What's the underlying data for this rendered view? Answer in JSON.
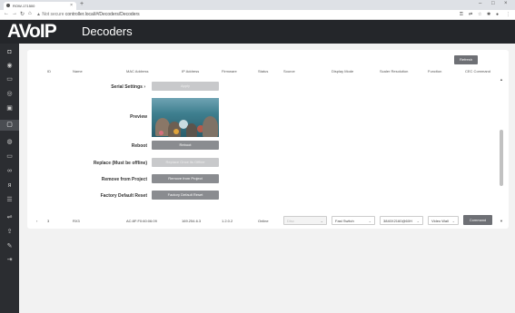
{
  "browser": {
    "tab_title": "ROW-171500",
    "tab_close": "×",
    "new_tab": "+",
    "url_warning": "▲ Not secure",
    "url": "controller.local/#/Decoders/Decoders",
    "window_controls": [
      "–",
      "□",
      "×"
    ]
  },
  "app": {
    "logo": "AVoIP",
    "page_title": "Decoders"
  },
  "sidebar": {
    "items": [
      {
        "icon": "dashboard-icon",
        "glyph": "◘"
      },
      {
        "icon": "source-icon",
        "glyph": "◉"
      },
      {
        "icon": "encoders-icon",
        "glyph": "▭"
      },
      {
        "icon": "globe-icon",
        "glyph": "◎"
      },
      {
        "icon": "device-icon",
        "glyph": "▣"
      },
      {
        "icon": "decoders-icon",
        "glyph": "▢"
      },
      {
        "icon": "settings-icon",
        "glyph": "◍"
      },
      {
        "icon": "video-wall-icon",
        "glyph": "▭"
      },
      {
        "icon": "link-icon",
        "glyph": "∞"
      },
      {
        "icon": "user-icon",
        "glyph": "ᴙ"
      },
      {
        "icon": "list-icon",
        "glyph": "☰"
      },
      {
        "icon": "network-icon",
        "glyph": "⇌"
      },
      {
        "icon": "upload-icon",
        "glyph": "⇪"
      },
      {
        "icon": "tools-icon",
        "glyph": "✎"
      },
      {
        "icon": "logout-icon",
        "glyph": "⇥"
      }
    ]
  },
  "toolbar": {
    "refresh_label": "Refresh"
  },
  "table": {
    "headers": [
      "ID",
      "Name",
      "MAC Address",
      "IP Address",
      "Firmware",
      "Status",
      "Source",
      "Display Mode",
      "Scaler Resolution",
      "Function",
      "CEC Command"
    ],
    "row": {
      "id": "3",
      "name": "RX3",
      "mac": "AC:8F:F0:60:06:09",
      "ip": "169.254.6.3",
      "firmware": "1.2.0.2",
      "status": "Online",
      "source": "Disc",
      "display_mode": "Fast Switch",
      "scaler_resolution": "3840X2160@60H",
      "function": "Video Wall",
      "cec_command": "Command"
    }
  },
  "details": {
    "serial_settings_label": "Serial Settings",
    "serial_settings_arrow": "›",
    "apply_label": "Apply",
    "preview_label": "Preview",
    "reboot_label": "Reboot",
    "reboot_button": "Reboot",
    "replace_label": "Replace (Must be offline)",
    "replace_button": "Replace Once its Offline",
    "remove_label": "Remove from Project",
    "remove_button": "Remove from Project",
    "reset_label": "Factory Default Reset",
    "reset_button": "Factory Default Reset"
  },
  "colors": {
    "header_bg": "#24262a",
    "sidebar_bg": "#2b2d31",
    "button_bg": "#8a8c90",
    "accent_button": "#6e7075"
  }
}
